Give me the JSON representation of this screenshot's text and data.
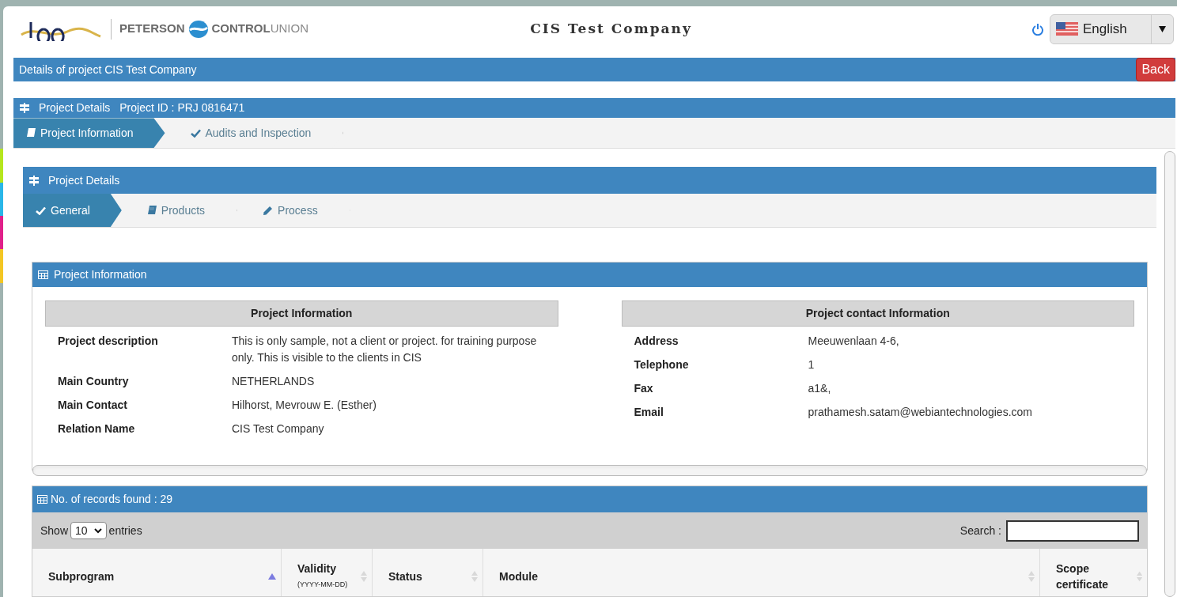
{
  "header": {
    "brand": [
      "PETERSON",
      "CONTROL",
      "UNION"
    ],
    "company": "CIS Test Company",
    "language": "English"
  },
  "title_bar": {
    "title": "Details of project CIS Test Company",
    "back": "Back"
  },
  "project_bar": {
    "label": "Project Details",
    "project_id": "Project ID : PRJ 0816471"
  },
  "main_tabs": [
    {
      "label": "Project Information",
      "kind": "book",
      "selected": true
    },
    {
      "label": "Audits and Inspection",
      "kind": "check",
      "selected": false
    }
  ],
  "details_panel": {
    "title": "Project Details",
    "tabs": [
      {
        "label": "General",
        "kind": "check",
        "selected": true
      },
      {
        "label": "Products",
        "kind": "book",
        "selected": false
      },
      {
        "label": "Process",
        "kind": "pencil",
        "selected": false
      }
    ]
  },
  "info_panel": {
    "title": "Project Information",
    "left": {
      "heading": "Project Information",
      "rows": [
        {
          "label": "Project description",
          "value": "This is only sample, not a client or project. for training purpose only. This is visible to the clients in CIS"
        },
        {
          "label": "Main Country",
          "value": "NETHERLANDS"
        },
        {
          "label": "Main Contact",
          "value": "Hilhorst, Mevrouw E. (Esther)"
        },
        {
          "label": "Relation Name",
          "value": "CIS Test Company"
        }
      ]
    },
    "right": {
      "heading": "Project contact Information",
      "rows": [
        {
          "label": "Address",
          "value": "Meeuwenlaan 4-6,"
        },
        {
          "label": "Telephone",
          "value": "1"
        },
        {
          "label": "Fax",
          "value": "a1&,"
        },
        {
          "label": "Email",
          "value": "prathamesh.satam@webiantechnologies.com"
        }
      ]
    }
  },
  "records": {
    "title": "No. of records found : 29",
    "show": "Show",
    "page_size": "10",
    "entries": "entries",
    "search_label": "Search :",
    "columns": [
      {
        "label": "Subprogram",
        "sorted": true
      },
      {
        "label": "Validity",
        "sub": "(YYYY-MM-DD)",
        "sorted": false
      },
      {
        "label": "Status",
        "sorted": false
      },
      {
        "label": "Module",
        "sorted": false
      },
      {
        "label": "Scope certificate",
        "sorted": false
      }
    ]
  }
}
